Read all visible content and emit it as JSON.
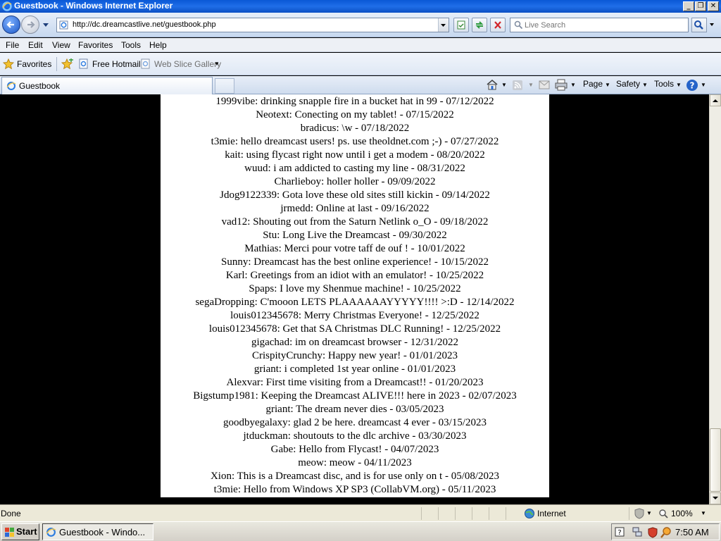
{
  "window": {
    "title": "Guestbook - Windows Internet Explorer"
  },
  "addressbar": {
    "url": "http://dc.dreamcastlive.net/guestbook.php",
    "search_placeholder": "Live Search"
  },
  "menubar": {
    "items": [
      "File",
      "Edit",
      "View",
      "Favorites",
      "Tools",
      "Help"
    ]
  },
  "favbar": {
    "favorites": "Favorites",
    "free_hotmail": "Free Hotmail",
    "web_slice_gallery": "Web Slice Gallery"
  },
  "tabs": [
    {
      "label": "Guestbook"
    }
  ],
  "commandbar": {
    "page": "Page",
    "safety": "Safety",
    "tools": "Tools"
  },
  "page": {
    "entries": [
      "1999vibe: drinking snapple fire in a bucket hat in 99 - 07/12/2022",
      "Neotext: Conecting on my tablet! - 07/15/2022",
      "bradicus: \\w - 07/18/2022",
      "t3mie: hello dreamcast users! ps. use theoldnet.com ;-) - 07/27/2022",
      "kait: using flycast right now until i get a modem - 08/20/2022",
      "wuud: i am addicted to casting my line - 08/31/2022",
      "Charlieboy: holler holler - 09/09/2022",
      "Jdog9122339: Gota love these old sites still kickin - 09/14/2022",
      "jrmedd: Online at last - 09/16/2022",
      "vad12: Shouting out from the Saturn Netlink o_O - 09/18/2022",
      "Stu: Long Live the Dreamcast - 09/30/2022",
      "Mathias: Merci pour votre taff de ouf ! - 10/01/2022",
      "Sunny: Dreamcast has the best online experience! - 10/15/2022",
      "Karl: Greetings from an idiot with an emulator! - 10/25/2022",
      "Spaps: I love my Shenmue machine! - 10/25/2022",
      "segaDropping: C'mooon LETS PLAAAAAAYYYYY!!!! >:D - 12/14/2022",
      "louis012345678: Merry Christmas Everyone! - 12/25/2022",
      "louis012345678: Get that SA Christmas DLC Running! - 12/25/2022",
      "gigachad: im on dreamcast browser - 12/31/2022",
      "CrispityCrunchy: Happy new year! - 01/01/2023",
      "griant: i completed 1st year online - 01/01/2023",
      "Alexvar: First time visiting from a Dreamcast!! - 01/20/2023",
      "Bigstump1981: Keeping the Dreamcast ALIVE!!! here in 2023 - 02/07/2023",
      "griant: The dream never dies - 03/05/2023",
      "goodbyegalaxy: glad 2 be here. dreamcast 4 ever - 03/15/2023",
      "jtduckman: shoutouts to the dlc archive - 03/30/2023",
      "Gabe: Hello from Flycast! - 04/07/2023",
      "meow: meow - 04/11/2023",
      "Xion: This is a Dreamcast disc, and is for use only on t - 05/08/2023",
      "t3mie: Hello from Windows XP SP3 (CollabVM.org) - 05/11/2023"
    ]
  },
  "statusbar": {
    "text": "Done",
    "zone": "Internet",
    "zoom": "100%"
  },
  "taskbar": {
    "start": "Start",
    "task": "Guestbook - Windo...",
    "clock": "7:50 AM"
  },
  "colors": {
    "titlebar": "#0a58d6",
    "page_bg": "#ffffff",
    "outer_bg": "#000000"
  }
}
